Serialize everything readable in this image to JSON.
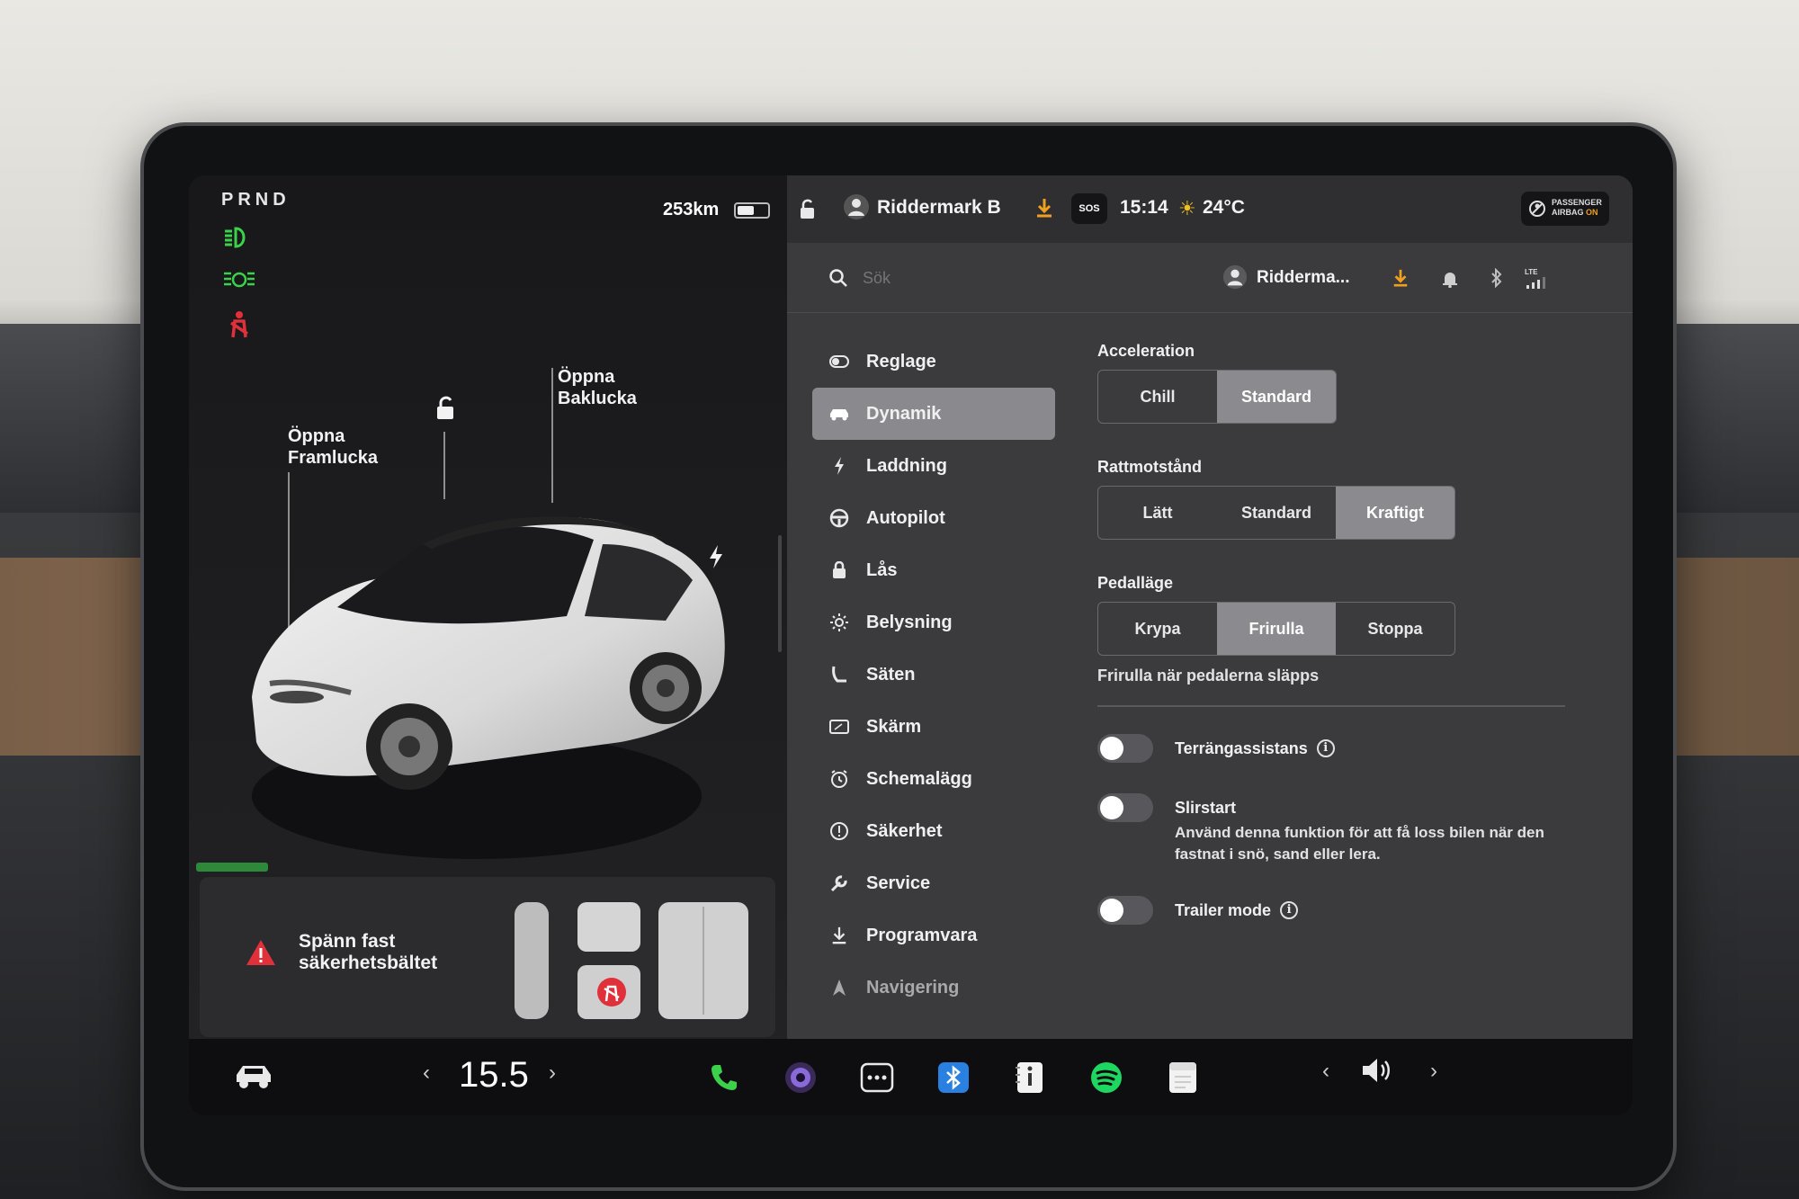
{
  "left": {
    "gear": "PRND",
    "range": "253km",
    "battery_level": 0.55,
    "callout_front": [
      "Öppna",
      "Framlucka"
    ],
    "callout_rear": [
      "Öppna",
      "Baklucka"
    ],
    "alert_text": [
      "Spänn fast",
      "säkerhetsbältet"
    ]
  },
  "topbar": {
    "profile": "Riddermark B",
    "time": "15:14",
    "temp": "24°C",
    "sos": "SOS",
    "airbag_line1": "PASSENGER",
    "airbag_line2": "AIRBAG",
    "airbag_state": "ON"
  },
  "searchbar": {
    "placeholder": "Sök",
    "profile_short": "Ridderma...",
    "signal": "LTE"
  },
  "menu": {
    "items": [
      {
        "label": "Reglage",
        "icon": "toggle-icon"
      },
      {
        "label": "Dynamik",
        "icon": "car-icon"
      },
      {
        "label": "Laddning",
        "icon": "bolt-icon"
      },
      {
        "label": "Autopilot",
        "icon": "steering-wheel-icon"
      },
      {
        "label": "Lås",
        "icon": "lock-icon"
      },
      {
        "label": "Belysning",
        "icon": "sun-icon"
      },
      {
        "label": "Säten",
        "icon": "seat-icon"
      },
      {
        "label": "Skärm",
        "icon": "display-icon"
      },
      {
        "label": "Schemalägg",
        "icon": "clock-icon"
      },
      {
        "label": "Säkerhet",
        "icon": "alert-circle-icon"
      },
      {
        "label": "Service",
        "icon": "wrench-icon"
      },
      {
        "label": "Programvara",
        "icon": "download-icon"
      },
      {
        "label": "Navigering",
        "icon": "navigation-icon"
      }
    ],
    "active_index": 1
  },
  "settings": {
    "acceleration": {
      "title": "Acceleration",
      "options": [
        "Chill",
        "Standard"
      ],
      "selected": 1
    },
    "steering": {
      "title": "Rattmotstånd",
      "options": [
        "Lätt",
        "Standard",
        "Kraftigt"
      ],
      "selected": 2
    },
    "pedal": {
      "title": "Pedalläge",
      "options": [
        "Krypa",
        "Frirulla",
        "Stoppa"
      ],
      "selected": 1,
      "hint": "Frirulla när pedalerna släpps"
    },
    "toggles": [
      {
        "label": "Terrängassistans",
        "info": true,
        "on": false
      },
      {
        "label": "Slirstart",
        "info": false,
        "on": false,
        "desc": "Använd denna funktion för att få loss bilen när den fastnat i snö, sand eller lera."
      },
      {
        "label": "Trailer mode",
        "info": true,
        "on": false
      }
    ]
  },
  "bottom": {
    "temp_setting": "15.5",
    "dock_icons": [
      "phone-icon",
      "camera-icon",
      "more-icon",
      "bluetooth-icon",
      "notes-icon",
      "spotify-icon",
      "calendar-icon"
    ]
  },
  "colors": {
    "telltale_green": "#3bd14a",
    "telltale_red": "#e0303a",
    "download_orange": "#f0a020",
    "selected_segment": "#8b8b8f"
  }
}
